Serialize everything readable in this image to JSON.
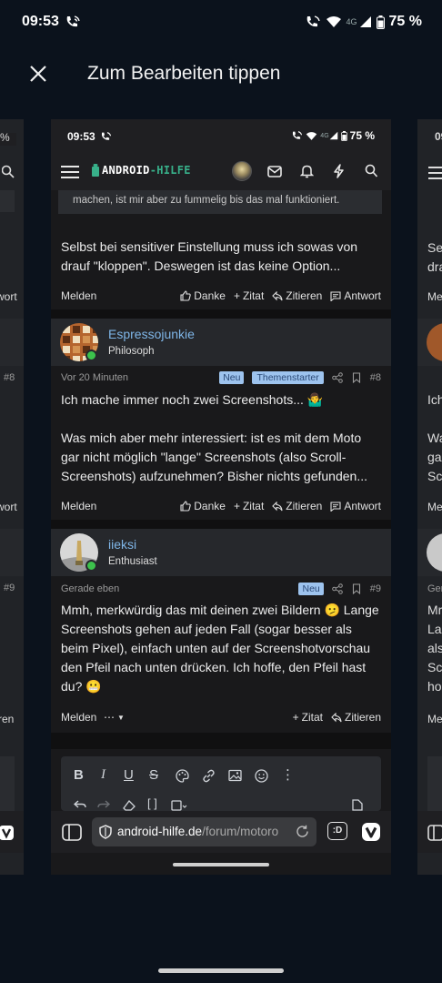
{
  "status_bar": {
    "time": "09:53",
    "network": "4G",
    "battery": "75 %"
  },
  "header": {
    "title": "Zum Bearbeiten tippen",
    "close_icon": "close-icon"
  },
  "left_card": {
    "fragments": [
      "%",
      "wort",
      "#8",
      "wort",
      "#9",
      "ren"
    ]
  },
  "right_card": {
    "fragments": [
      "09",
      "Se",
      "dra",
      "Me",
      "Ich",
      "Wa",
      "ga",
      "Sc",
      "Me",
      "Ger",
      "Mr",
      "La",
      "als",
      "Sc",
      "ho",
      "Me"
    ]
  },
  "card": {
    "status": {
      "time": "09:53",
      "network": "4G",
      "battery": "75 %"
    },
    "logo": {
      "part1": "ANDROID",
      "part2": "-HILFE"
    },
    "post_top": {
      "quote_text": "machen, ist mir aber zu fummelig bis das mal funktioniert.",
      "text": "Selbst bei sensitiver Einstellung muss ich sowas von drauf \"kloppen\". Deswegen ist das keine Option...",
      "report": "Melden",
      "actions": [
        "Danke",
        "Zitat",
        "Zitieren",
        "Antwort"
      ]
    },
    "post8": {
      "username": "Espressojunkie",
      "role": "Philosoph",
      "time": "Vor 20 Minuten",
      "badge_new": "Neu",
      "badge_starter": "Themenstarter",
      "number": "#8",
      "para1": "Ich mache immer noch zwei Screenshots... 🤷‍♂️",
      "para2": "Was mich aber mehr interessiert: ist es mit dem Moto gar nicht möglich \"lange\" Screenshots (also Scroll-Screenshots) aufzunehmen? Bisher nichts gefunden...",
      "report": "Melden",
      "actions": [
        "Danke",
        "Zitat",
        "Zitieren",
        "Antwort"
      ]
    },
    "post9": {
      "username": "iieksi",
      "role": "Enthusiast",
      "time": "Gerade eben",
      "badge_new": "Neu",
      "number": "#9",
      "text": "Mmh, merkwürdig das mit deinen zwei Bildern 🫤 Lange Screenshots gehen auf jeden Fall (sogar besser als beim Pixel), einfach unten auf der Screenshotvorschau den Pfeil nach unten drücken. Ich hoffe, den Pfeil hast du? 😬",
      "report": "Melden",
      "more": "⋯",
      "actions": [
        "Zitat",
        "Zitieren"
      ]
    },
    "url": {
      "host": "android-hilfe.de",
      "path": "/forum/motoro",
      "tabs_label": ":D"
    }
  }
}
